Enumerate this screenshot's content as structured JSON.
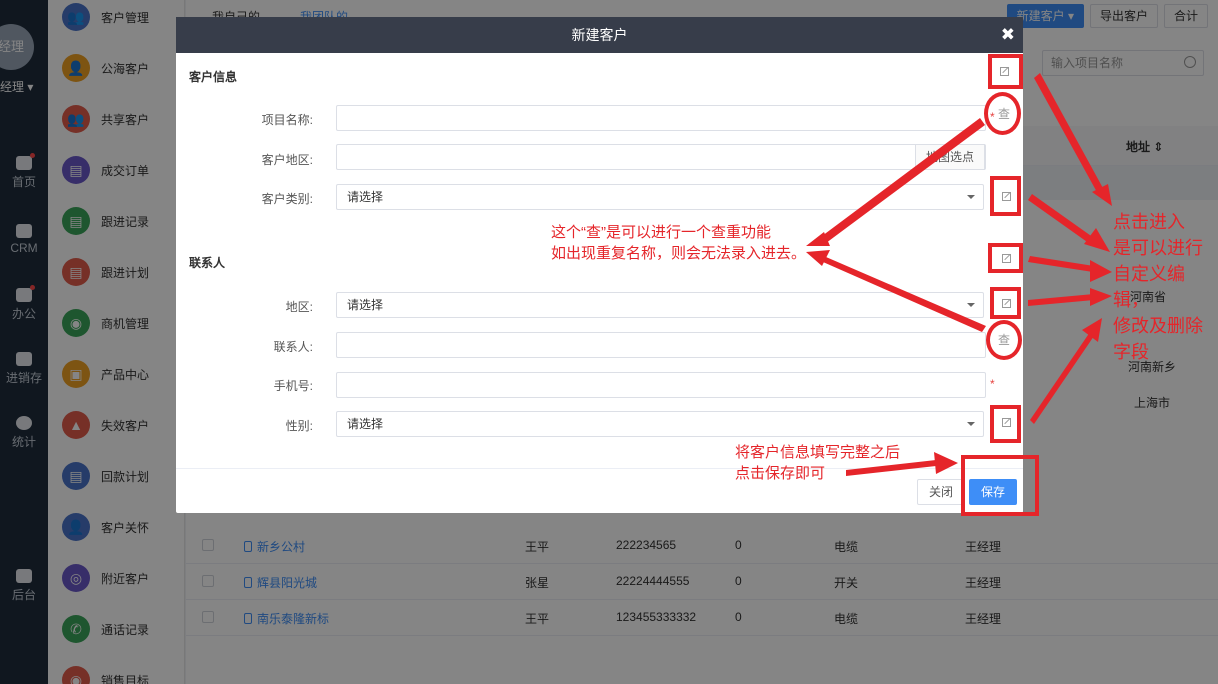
{
  "rail": {
    "avatar_text": "经理",
    "user_name": "经理",
    "user_caret": "▾",
    "items": [
      "首页",
      "CRM",
      "办公",
      "进销存",
      "统计",
      "后台"
    ]
  },
  "side": {
    "items": [
      {
        "label": "客户管理",
        "color": "#4a73c9",
        "glyph": "👥"
      },
      {
        "label": "公海客户",
        "color": "#f0a123",
        "glyph": "👤"
      },
      {
        "label": "共享客户",
        "color": "#e25c4c",
        "glyph": "👥"
      },
      {
        "label": "成交订单",
        "color": "#6a58c9",
        "glyph": "▤"
      },
      {
        "label": "跟进记录",
        "color": "#3aa55a",
        "glyph": "▤"
      },
      {
        "label": "跟进计划",
        "color": "#e25c4c",
        "glyph": "▤"
      },
      {
        "label": "商机管理",
        "color": "#3aa55a",
        "glyph": "◉"
      },
      {
        "label": "产品中心",
        "color": "#f0a123",
        "glyph": "▣"
      },
      {
        "label": "失效客户",
        "color": "#e25c4c",
        "glyph": "▲"
      },
      {
        "label": "回款计划",
        "color": "#4a73c9",
        "glyph": "▤"
      },
      {
        "label": "客户关怀",
        "color": "#4a73c9",
        "glyph": "👤"
      },
      {
        "label": "附近客户",
        "color": "#6a58c9",
        "glyph": "◎"
      },
      {
        "label": "通话记录",
        "color": "#3aa55a",
        "glyph": "✆"
      },
      {
        "label": "销售目标",
        "color": "#e25c4c",
        "glyph": "◉"
      }
    ]
  },
  "main": {
    "tabs": [
      "我自己的",
      "我团队的"
    ],
    "new_customer": "新建客户",
    "export": "导出客户",
    "total": "合计",
    "search_placeholder": "输入项目名称",
    "address_header": "地址",
    "addresses": [
      "河南省",
      "河南新乡",
      "上海市"
    ],
    "rows": [
      {
        "name": "新乡公村",
        "contact": "王平",
        "phone": "222234565",
        "count": "0",
        "type": "电缆",
        "owner": "王经理"
      },
      {
        "name": "辉县阳光城",
        "contact": "张星",
        "phone": "22224444555",
        "count": "0",
        "type": "开关",
        "owner": "王经理"
      },
      {
        "name": "南乐泰隆新标",
        "contact": "王平",
        "phone": "123455333332",
        "count": "0",
        "type": "电缆",
        "owner": "王经理"
      }
    ]
  },
  "modal": {
    "title": "新建客户",
    "close": "✖",
    "section_customer": "客户信息",
    "section_contact": "联系人",
    "fields": {
      "project_name": "项目名称:",
      "region": "客户地区:",
      "map_pick": "地图选点",
      "category": "客户类别:",
      "area": "地区:",
      "contact": "联系人:",
      "mobile": "手机号:",
      "gender": "性别:"
    },
    "select_placeholder": "请选择",
    "check_label": "查",
    "required": "*",
    "btn_close": "关闭",
    "btn_save": "保存"
  },
  "annotations": {
    "check_note": [
      "这个“查”是可以进行一个查重功能",
      "如出现重复名称，则会无法录入进去。"
    ],
    "edit_note": [
      "点击进入",
      "是可以进行",
      "自定义编",
      "辑，",
      "修改及删除",
      "字段"
    ],
    "save_note": [
      "将客户信息填写完整之后",
      "点击保存即可"
    ]
  }
}
